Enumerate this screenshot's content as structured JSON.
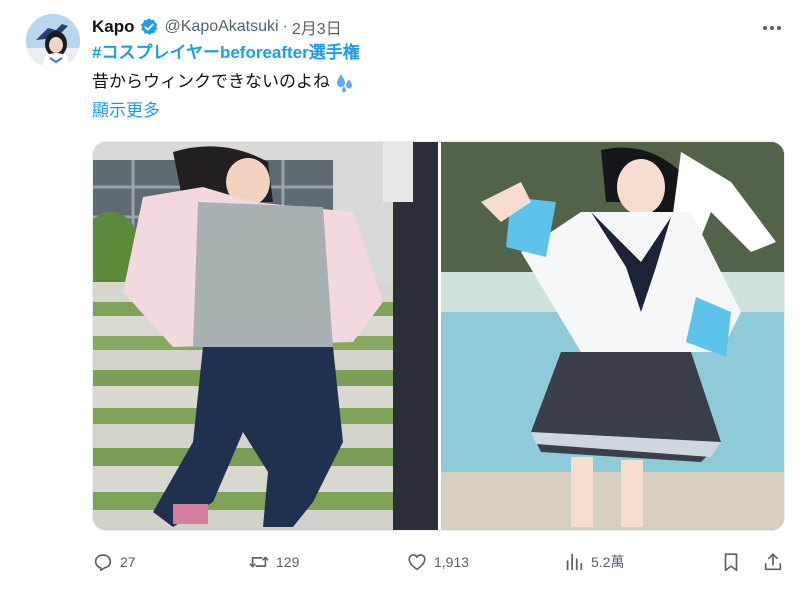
{
  "tweet": {
    "author": {
      "name": "Kapo",
      "handle": "@KapoAkatsuki",
      "separator": "·",
      "date": "2月3日",
      "avatar_icon": "avatar-photo",
      "verified_icon": "verified-badge-icon",
      "verified_color": "#1d9bf0"
    },
    "hashtag": "#コスプレイヤーbeforeafter選手権",
    "body": "昔からウィンクできないのよね",
    "body_emoji": "sweat-droplets-icon",
    "show_more": "顯示更多",
    "more_icon": "more-options-icon",
    "media": [
      {
        "name": "before-photo",
        "kind": "photo"
      },
      {
        "name": "after-cosplay-photo",
        "kind": "photo"
      }
    ],
    "actions": {
      "reply": {
        "icon": "reply-icon",
        "count": "27"
      },
      "retweet": {
        "icon": "retweet-icon",
        "count": "129"
      },
      "like": {
        "icon": "heart-icon",
        "count": "1,913"
      },
      "views": {
        "icon": "views-bar-chart-icon",
        "count": "5.2萬"
      },
      "bookmark": {
        "icon": "bookmark-icon"
      },
      "share": {
        "icon": "share-icon"
      }
    },
    "colors": {
      "link": "#1d9bf0",
      "text": "#0f1419",
      "muted": "#536471"
    }
  }
}
